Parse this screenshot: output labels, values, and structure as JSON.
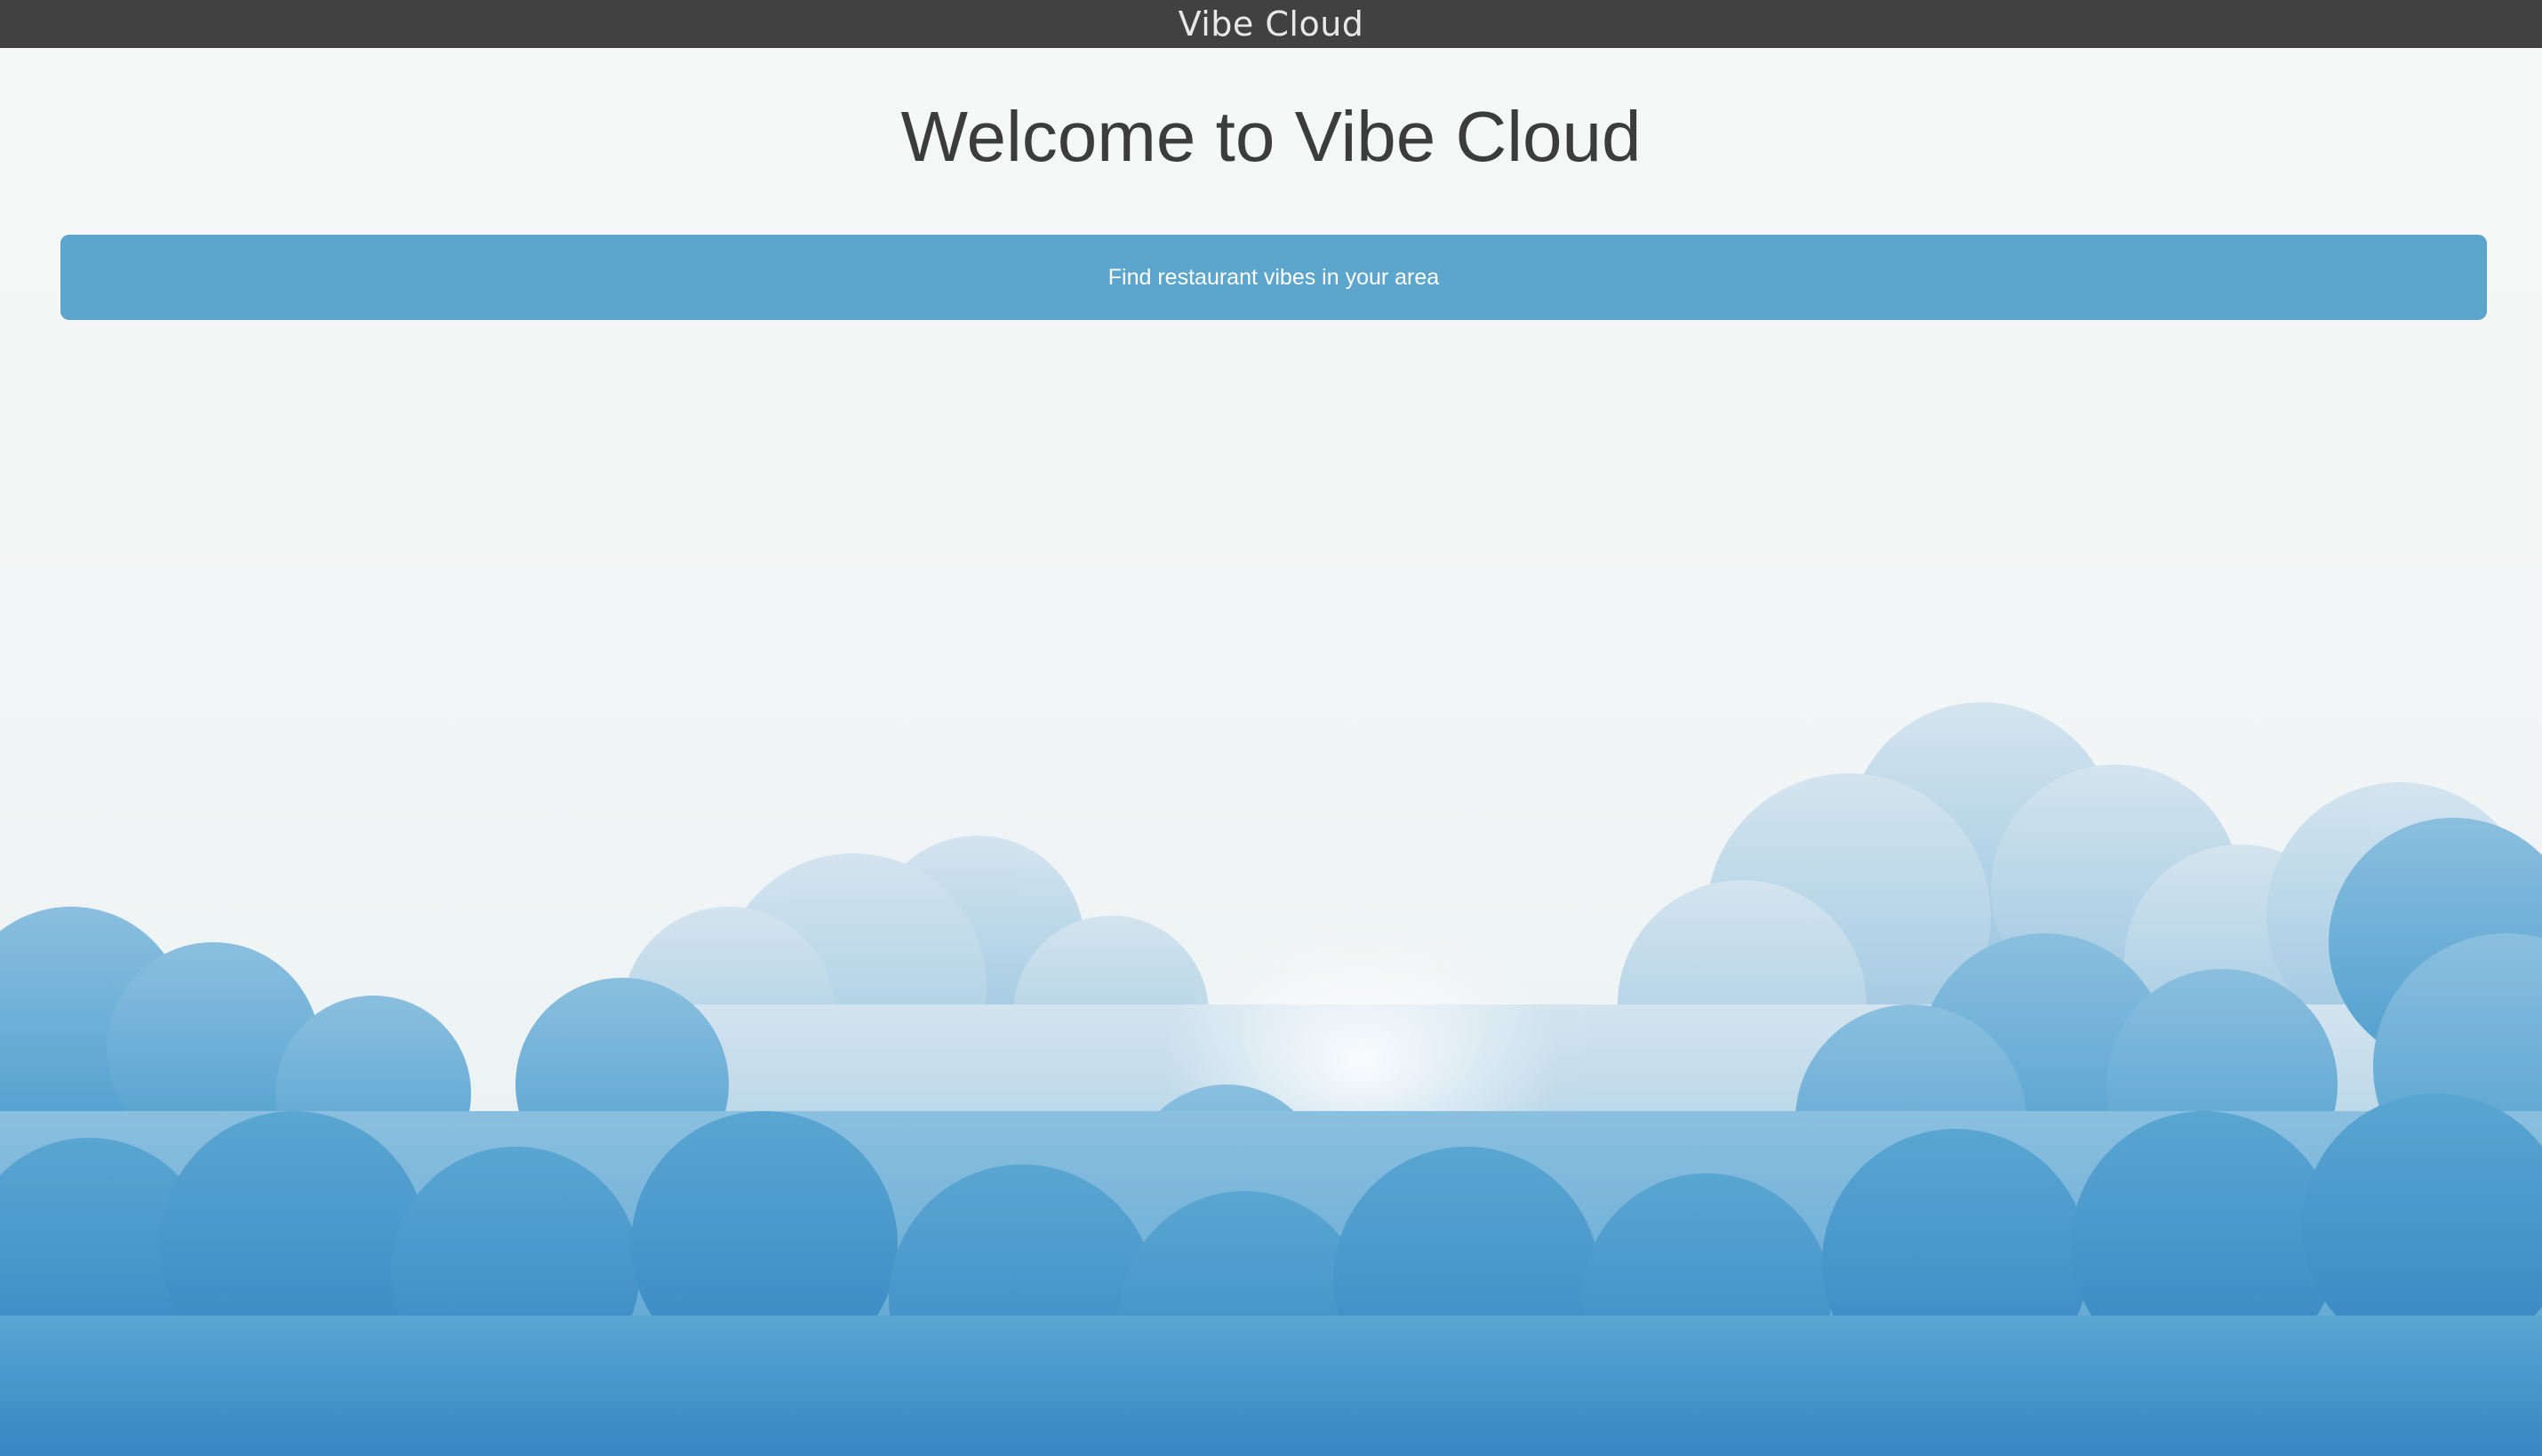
{
  "app": {
    "title": "Vibe Cloud"
  },
  "main": {
    "heading": "Welcome to Vibe Cloud",
    "find_button_label": "Find restaurant vibes in your area"
  },
  "colors": {
    "topbar": "#414141",
    "button": "#5ca6cd",
    "heading_text": "#3c3c3c",
    "cloud_blue": "#4a9fd0"
  },
  "background": {
    "icon": "sky-clouds-image"
  }
}
